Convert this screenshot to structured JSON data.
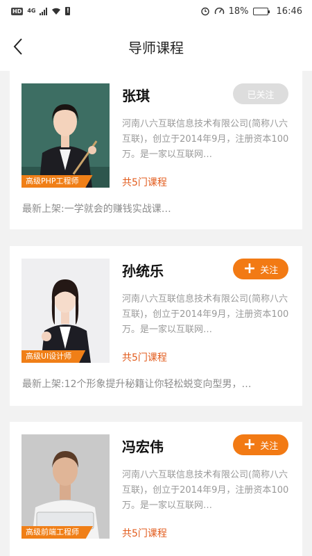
{
  "status_bar": {
    "hd_label": "HD",
    "network": "4G",
    "battery_percent": "18%",
    "time": "16:46",
    "battery_level": 0.18,
    "icons": [
      "hd-icon",
      "signal-icon",
      "wifi-icon",
      "alert-icon",
      "alarm-icon",
      "speed-icon",
      "battery-icon"
    ]
  },
  "header": {
    "title": "导师课程",
    "back_icon": "back-arrow-icon"
  },
  "teachers": [
    {
      "name": "张琪",
      "follow_label": "已关注",
      "followed": true,
      "title_tag": "高级PHP工程师",
      "description": "河南八六互联信息技术有限公司(简称八六互联)，创立于2014年9月，注册资本100万。是一家以互联网…",
      "course_count": "共5门课程",
      "latest": "最新上架:一学就会的赚钱实战课…"
    },
    {
      "name": "孙统乐",
      "follow_label": "关注",
      "followed": false,
      "title_tag": "高级UI设计师",
      "description": "河南八六互联信息技术有限公司(简称八六互联)，创立于2014年9月，注册资本100万。是一家以互联网…",
      "course_count": "共5门课程",
      "latest": "最新上架:12个形象提升秘籍让你轻松蜕变向型男，…"
    },
    {
      "name": "冯宏伟",
      "follow_label": "关注",
      "followed": false,
      "title_tag": "高级前端工程师",
      "description": "河南八六互联信息技术有限公司(简称八六互联)，创立于2014年9月，注册资本100万。是一家以互联网…",
      "course_count": "共5门课程",
      "latest": ""
    }
  ],
  "colors": {
    "accent": "#f27a14",
    "followed_bg": "#dddddd",
    "course_count": "#e25b1c",
    "page_bg": "#f2f2f2"
  }
}
